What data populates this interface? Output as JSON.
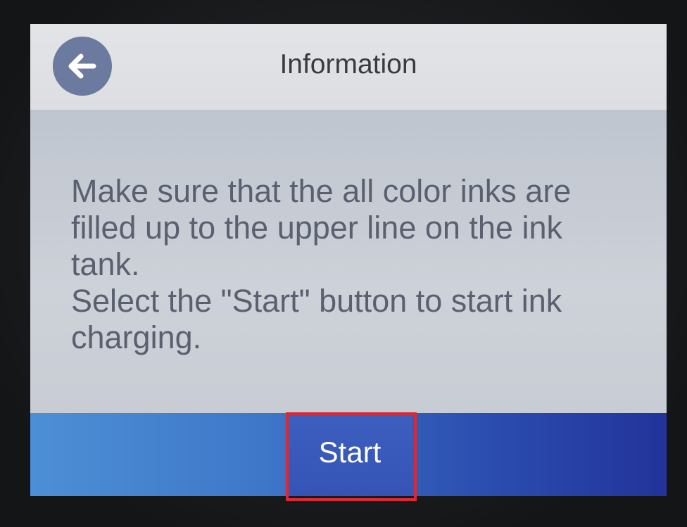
{
  "header": {
    "title": "Information",
    "back_icon": "arrow-left-icon"
  },
  "message": {
    "text": "Make sure that the all color inks are\nfilled up to the upper line on the ink\ntank.\nSelect the \"Start\" button to start ink\ncharging."
  },
  "footer": {
    "start_label": "Start"
  },
  "colors": {
    "header_bg": "#e1e3e6",
    "body_bg": "#c7ccd6",
    "footer_gradient_start": "#4d8fd6",
    "footer_gradient_end": "#22339a",
    "highlight_border": "#d62b36"
  }
}
